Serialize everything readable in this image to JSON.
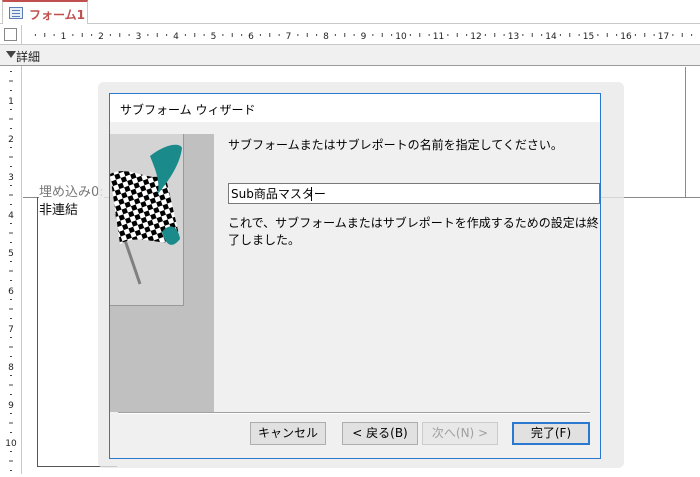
{
  "document_tab": {
    "label": "フォーム1"
  },
  "ruler": {
    "horizontal_marks": [
      "1",
      "2",
      "3",
      "4",
      "5",
      "6",
      "7",
      "8",
      "9",
      "10",
      "11",
      "12",
      "13",
      "14",
      "15",
      "16",
      "17"
    ],
    "vertical_marks": [
      "1",
      "2",
      "3",
      "4",
      "5",
      "6",
      "7",
      "8",
      "9",
      "10"
    ]
  },
  "section": {
    "label": "詳細"
  },
  "form": {
    "embed_label": "埋め込み0:",
    "unbound_label": "非連結"
  },
  "dialog": {
    "title": "サブフォーム ウィザード",
    "instruction": "サブフォームまたはサブレポートの名前を指定してください。",
    "name_value": "Sub商品マスター",
    "completion_message": "これで、サブフォームまたはサブレポートを作成するための設定は終了しました。",
    "buttons": {
      "cancel": "キャンセル",
      "back": "< 戻る(B)",
      "next": "次へ(N) >",
      "finish": "完了(F)"
    },
    "colors": {
      "accent": "#2b78d0",
      "flag_teal": "#1a8a8a",
      "tab_accent": "#c0504d"
    }
  }
}
